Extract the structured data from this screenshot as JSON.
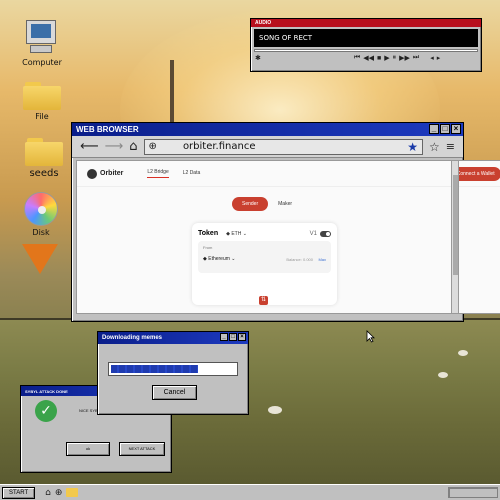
{
  "desktop": {
    "icons": [
      {
        "label": "Computer",
        "icon": "computer-icon"
      },
      {
        "label": "File",
        "icon": "folder-icon"
      },
      {
        "label": "seeds",
        "icon": "folder-icon"
      },
      {
        "label": "Disk",
        "icon": "disk-icon"
      },
      {
        "label": "",
        "icon": "metamask-fox-icon"
      }
    ]
  },
  "audio": {
    "title": "AUDIO",
    "track_name": "SONG OF RECT",
    "controls": [
      "⏮",
      "◀◀",
      "■",
      "▶",
      "⏸",
      "▶▶",
      "⏭"
    ]
  },
  "browser": {
    "title": "WEB BROWSER",
    "url": "orbiter.finance",
    "site": {
      "logo": "Orbiter",
      "nav": [
        "L2 Bridge",
        "L2 Data"
      ],
      "connect_label": "Connect a Wallet",
      "segment": [
        "Sender",
        "Maker"
      ],
      "token_label": "Token",
      "token_value": "ETH",
      "version": "V1",
      "from_label": "From",
      "from_chain": "Ethereum",
      "balance": "Balance: 0.000",
      "max_label": "Max"
    }
  },
  "download": {
    "title": "Downloading memes",
    "progress": 0.7,
    "cancel_label": "Cancel"
  },
  "sybil": {
    "title": "SYBYL ATTACK DONE",
    "message": "NICE SYBYL ATTACK BRRRRR",
    "ok_label": "ok",
    "next_label": "NEXT ATTACK"
  },
  "taskbar": {
    "start_label": "START"
  },
  "colors": {
    "titlebar": "#0a1e8a",
    "accent": "#c9402f",
    "audio_titlebar": "#b80f1d"
  }
}
